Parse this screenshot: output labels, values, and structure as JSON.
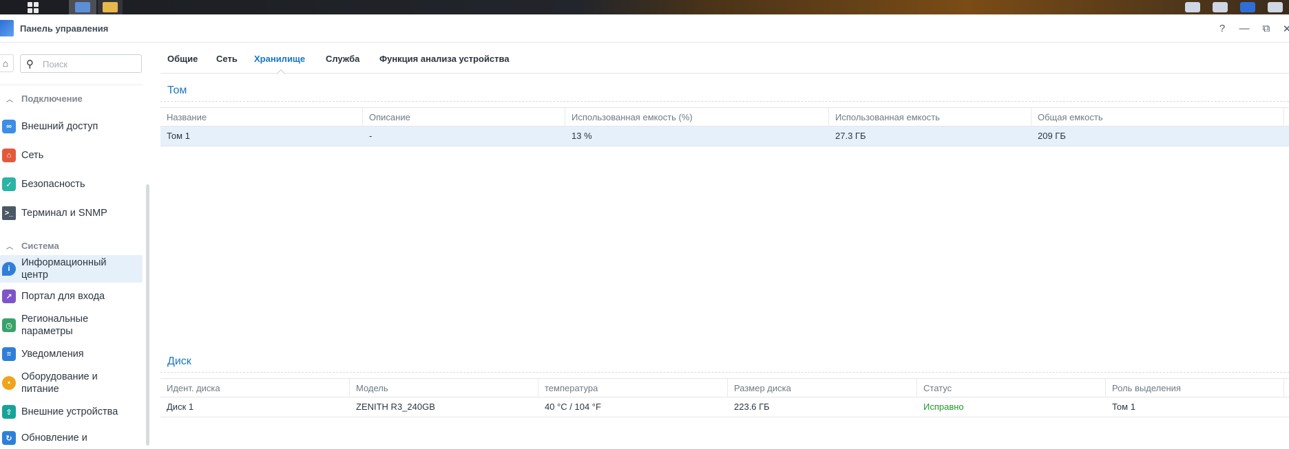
{
  "window": {
    "title": "Панель управления",
    "controls": [
      "?",
      "—",
      "⧉",
      "✕"
    ]
  },
  "sidebar": {
    "search_placeholder": "Поиск",
    "groups": [
      {
        "label": "Подключение"
      },
      {
        "label": "Система"
      }
    ],
    "items": [
      {
        "label": "Внешний доступ",
        "icon": "link-icon",
        "color": "#3c8ee6"
      },
      {
        "label": "Сеть",
        "icon": "house-network-icon",
        "color": "#e25a3b"
      },
      {
        "label": "Безопасность",
        "icon": "shield-check-icon",
        "color": "#2bb3a5"
      },
      {
        "label": "Терминал и SNMP",
        "icon": "terminal-icon",
        "color": "#4a5866"
      },
      {
        "label": "Информационный центр",
        "icon": "info-pin-icon",
        "color": "#2f7fd8"
      },
      {
        "label": "Портал для входа",
        "icon": "portal-icon",
        "color": "#7e55c9"
      },
      {
        "label": "Региональные параметры",
        "icon": "regional-globe-icon",
        "color": "#3aa36a"
      },
      {
        "label": "Уведомления",
        "icon": "chat-bubble-icon",
        "color": "#2f7fd8"
      },
      {
        "label": "Оборудование и питание",
        "icon": "bulb-icon",
        "color": "#f1a31b"
      },
      {
        "label": "Внешние устройства",
        "icon": "external-device-icon",
        "color": "#17a398"
      },
      {
        "label": "Обновление и",
        "icon": "update-icon",
        "color": "#2f7fd8"
      }
    ]
  },
  "tabs": [
    "Общие",
    "Сеть",
    "Хранилище",
    "Служба",
    "Функция анализа устройства"
  ],
  "volume": {
    "title": "Том",
    "columns": [
      "Название",
      "Описание",
      "Использованная емкость (%)",
      "Использованная емкость",
      "Общая емкость"
    ],
    "rows": [
      [
        "Том 1",
        "-",
        "13 %",
        "27.3 ГБ",
        "209 ГБ"
      ]
    ]
  },
  "disk": {
    "title": "Диск",
    "columns": [
      "Идент. диска",
      "Модель",
      "температура",
      "Размер диска",
      "Статус",
      "Роль выделения"
    ],
    "rows": [
      [
        "Диск 1",
        "ZENITH R3_240GB",
        "40 °C / 104 °F",
        "223.6 ГБ",
        "Исправно",
        "Том 1"
      ]
    ]
  },
  "colors": {
    "accent": "#1576c8",
    "status_ok": "#1f9a28",
    "selection": "#e6f0fa"
  }
}
